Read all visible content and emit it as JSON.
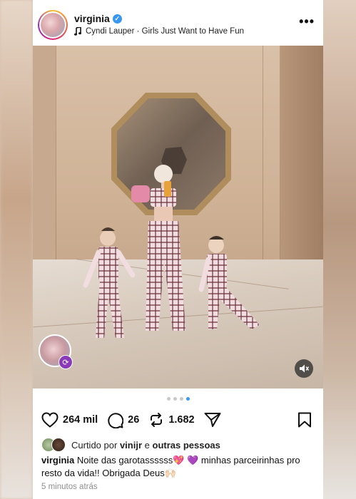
{
  "post": {
    "username": "virginia",
    "audio": "Cyndi Lauper · Girls Just Want to Have Fun",
    "media": {
      "carousel_count": 4,
      "active_index": 3
    },
    "actions": {
      "likes": "264 mil",
      "comments": "26",
      "reposts": "1.682"
    },
    "liked_by": {
      "prefix": "Curtido por",
      "user": "vinijr",
      "joiner": "e",
      "others": "outras pessoas"
    },
    "caption": {
      "author": "virginia",
      "text_part1": "Noite das garotassssss",
      "emoji1": "💖",
      "emoji2": "💜",
      "text_part2": "minhas parceirinhas pro resto da vida!! Obrigada Deus",
      "emoji3": "🙌🏻"
    },
    "timestamp": "5 minutos atrás"
  },
  "icons": {
    "verified": "verified-badge-icon",
    "audio": "music-note-icon",
    "more": "more-options-icon",
    "like": "heart-icon",
    "comment": "comment-icon",
    "repost": "repost-icon",
    "share": "send-icon",
    "save": "bookmark-icon",
    "mute": "speaker-muted-icon",
    "remix": "remix-icon"
  },
  "colors": {
    "accent": "#3897f0",
    "text": "#111111",
    "muted": "#8e8e8e"
  }
}
